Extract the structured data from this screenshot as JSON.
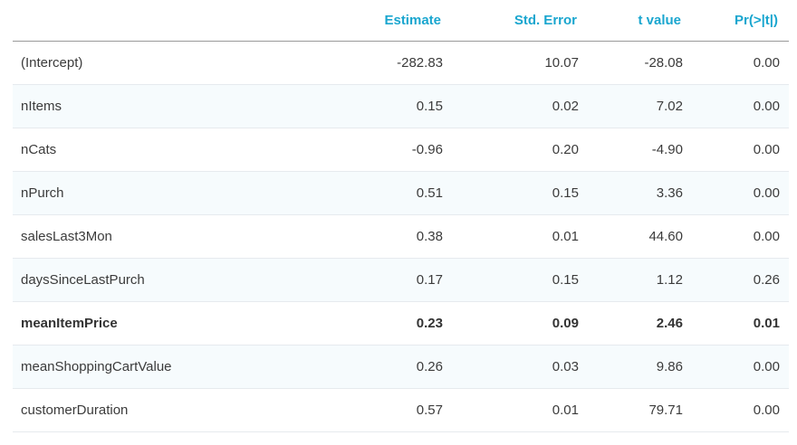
{
  "table": {
    "headers": [
      "",
      "Estimate",
      "Std. Error",
      "t value",
      "Pr(>|t|)"
    ],
    "rows": [
      [
        "(Intercept)",
        "-282.83",
        "10.07",
        "-28.08",
        "0.00"
      ],
      [
        "nItems",
        "0.15",
        "0.02",
        "7.02",
        "0.00"
      ],
      [
        "nCats",
        "-0.96",
        "0.20",
        "-4.90",
        "0.00"
      ],
      [
        "nPurch",
        "0.51",
        "0.15",
        "3.36",
        "0.00"
      ],
      [
        "salesLast3Mon",
        "0.38",
        "0.01",
        "44.60",
        "0.00"
      ],
      [
        "daysSinceLastPurch",
        "0.17",
        "0.15",
        "1.12",
        "0.26"
      ],
      [
        "meanItemPrice",
        "0.23",
        "0.09",
        "2.46",
        "0.01"
      ],
      [
        "meanShoppingCartValue",
        "0.26",
        "0.03",
        "9.86",
        "0.00"
      ],
      [
        "customerDuration",
        "0.57",
        "0.01",
        "79.71",
        "0.00"
      ]
    ],
    "bold_rows": [
      6
    ],
    "colors": {
      "header": "#1aa6cf",
      "text": "#3b3b3b",
      "alt_row_bg": "#f6fbfd"
    }
  }
}
